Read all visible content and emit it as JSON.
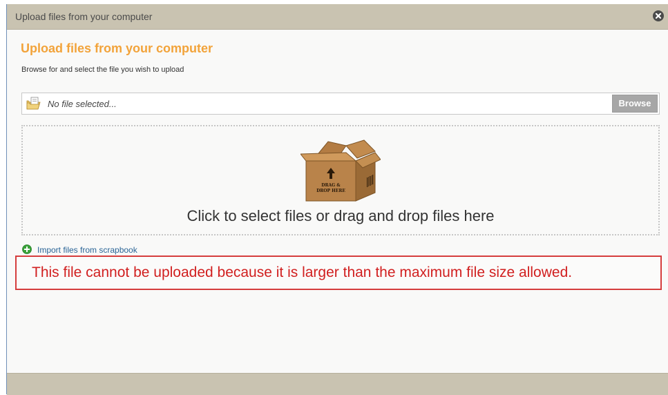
{
  "dialog": {
    "title": "Upload files from your computer",
    "close_icon": "close-circle-icon"
  },
  "main": {
    "heading": "Upload files from your computer",
    "subheading": "Browse for and select the file you wish to upload",
    "file_input": {
      "icon": "folder-file-icon",
      "placeholder": "No file selected...",
      "browse_label": "Browse"
    },
    "dropzone": {
      "icon": "cardboard-box-icon",
      "box_label_line1": "DRAG &",
      "box_label_line2": "DROP HERE",
      "text": "Click to select files or drag and drop files here"
    },
    "import_link": {
      "icon": "green-plus-circle-icon",
      "label": "Import files from scrapbook"
    },
    "error_message": "This file cannot be uploaded because it is larger than the maximum file size allowed."
  },
  "colors": {
    "heading": "#f2a33a",
    "titlebar": "#c9c3b1",
    "error": "#d11f1f",
    "link": "#2a6496",
    "browse_button": "#a7a7a7"
  }
}
